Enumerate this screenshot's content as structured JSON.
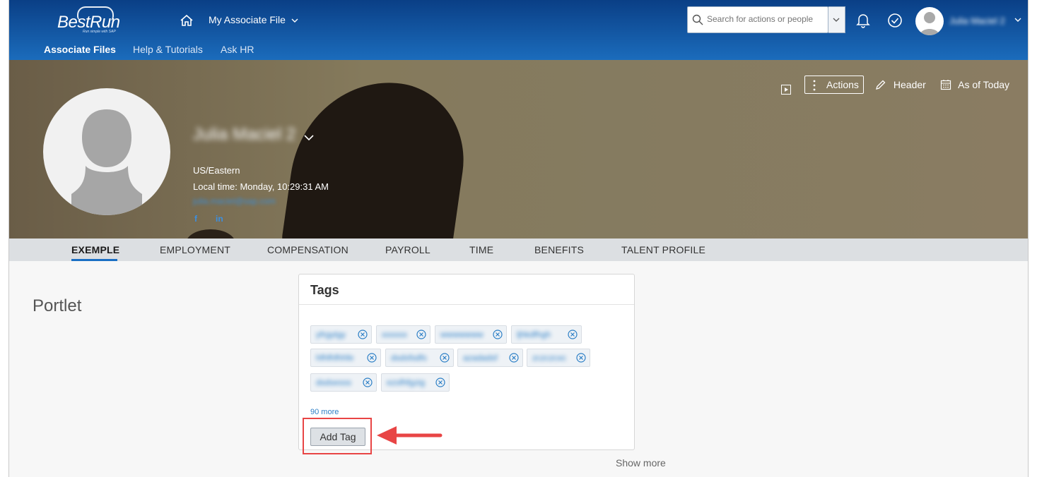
{
  "shell": {
    "logo_text": "BestRun",
    "logo_sub": "Run simple with SAP",
    "file_menu_label": "My Associate File",
    "subnav": [
      "Associate Files",
      "Help & Tutorials",
      "Ask HR"
    ],
    "search_placeholder": "Search for actions or people",
    "user_name": "Julia Maciel 2"
  },
  "hero": {
    "person_name": "Julia Maciel 2",
    "timezone": "US/Eastern",
    "local_time": "Local time: Monday, 10:29:31 AM",
    "email": "julia.maciel@sap.com",
    "social": [
      "f",
      "in"
    ],
    "actions_label": "Actions",
    "header_label": "Header",
    "as_of_label": "As of Today"
  },
  "tabs": [
    "EXEMPLE",
    "EMPLOYMENT",
    "COMPENSATION",
    "PAYROLL",
    "TIME",
    "BENEFITS",
    "TALENT PROFILE"
  ],
  "active_tab": "EXEMPLE",
  "portlet": {
    "title": "Portlet",
    "card_title": "Tags",
    "tags": [
      "yfrgytgy",
      "xxxxxx",
      "wwwwwww",
      "ljhkdfhgh",
      "hfhfhfhhfe",
      "dsdsfsdfs",
      "azadadsf",
      "zczczcxc",
      "dsdsesss",
      "ezsfhfgzig"
    ],
    "more_link": "90 more",
    "add_tag_label": "Add Tag",
    "show_more": "Show more"
  },
  "colors": {
    "shell_blue": "#1b6cbc",
    "link_blue": "#2c7fc6",
    "highlight_red": "#e84545"
  }
}
